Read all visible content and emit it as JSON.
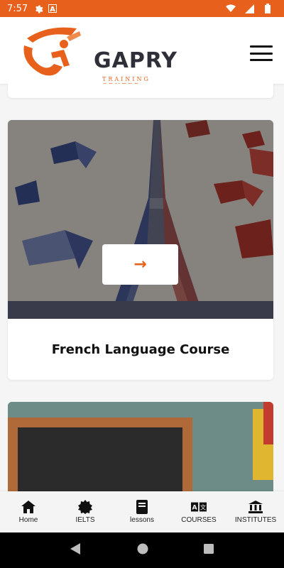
{
  "status_bar": {
    "time": "7:57",
    "left_icons": [
      "gear-icon",
      "text-a-icon"
    ],
    "right_icons": [
      "wifi-icon",
      "signal-icon",
      "battery-icon"
    ],
    "color": "#e8611c"
  },
  "header": {
    "logo_text": "GAPRY",
    "logo_subtext": "TRAINING CENTER",
    "menu_icon": "hamburger-icon"
  },
  "courses": [
    {
      "title": "French Language Course",
      "action_icon": "arrow-right-icon"
    }
  ],
  "bottom_nav": [
    {
      "label": "Home",
      "icon": "home-icon"
    },
    {
      "label": "IELTS",
      "icon": "badge-icon"
    },
    {
      "label": "lessons",
      "icon": "book-icon"
    },
    {
      "label": "COURSES",
      "icon": "translate-icon"
    },
    {
      "label": "INSTITUTES",
      "icon": "institute-icon"
    }
  ],
  "system_nav": [
    "back-icon",
    "home-circle-icon",
    "recents-icon"
  ],
  "colors": {
    "accent": "#e8611c",
    "text_dark": "#2f2f3a"
  }
}
